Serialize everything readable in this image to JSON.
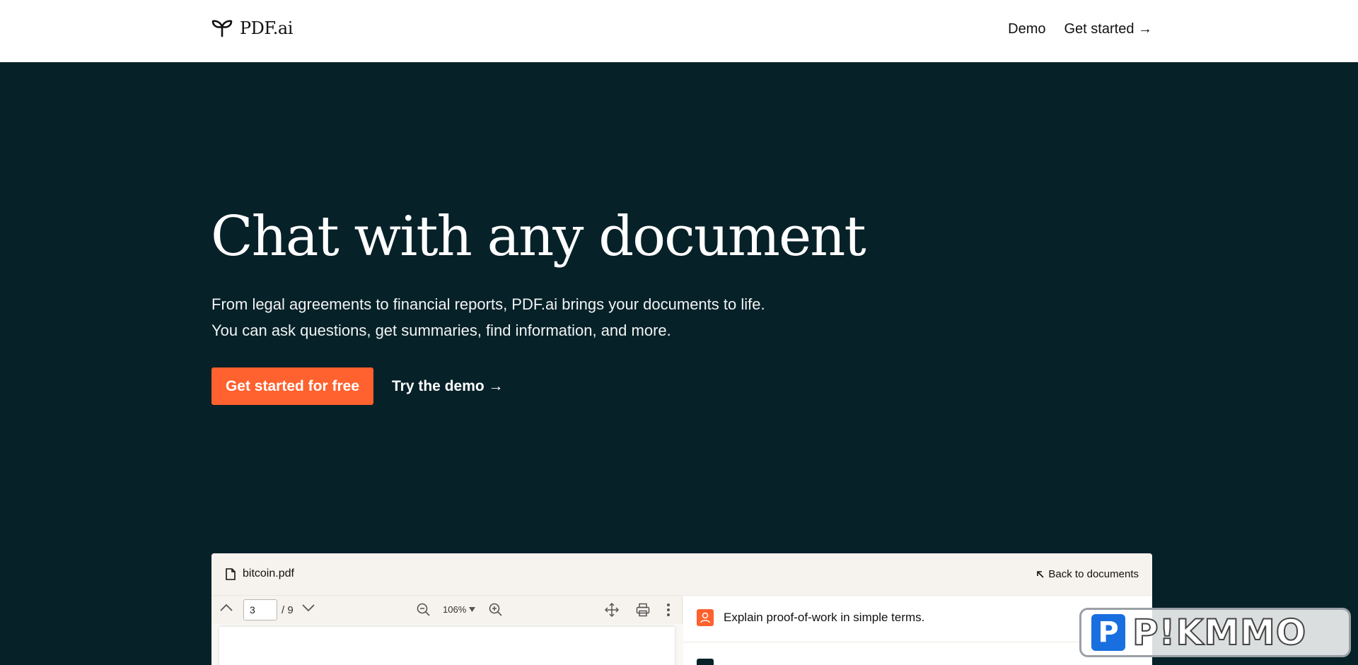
{
  "header": {
    "logo_text": "PDF.ai",
    "nav_demo": "Demo",
    "nav_get_started": "Get started →"
  },
  "hero": {
    "title": "Chat with any document",
    "subtitle_line1": "From legal agreements to financial reports, PDF.ai brings your documents to life.",
    "subtitle_line2": "You can ask questions, get summaries, find information, and more.",
    "cta_primary": "Get started for free",
    "cta_secondary": "Try the demo →"
  },
  "app_preview": {
    "file_name": "bitcoin.pdf",
    "back_link": "Back to documents",
    "toolbar": {
      "page_value": "3",
      "page_total": "/ 9",
      "zoom": "106%"
    },
    "chat": {
      "user_message": "Explain proof-of-work in simple terms."
    }
  },
  "watermark": {
    "badge": "P",
    "text": "P!KMMO"
  },
  "colors": {
    "background": "#072128",
    "accent": "#ff612f",
    "topbar": "#ffffff"
  },
  "icons": [
    "sprout-logo-icon",
    "file-icon",
    "arrow-up-left-icon",
    "chevron-up-icon",
    "chevron-down-icon",
    "zoom-out-icon",
    "zoom-in-icon",
    "move-icon",
    "print-icon",
    "more-vertical-icon",
    "user-icon"
  ]
}
